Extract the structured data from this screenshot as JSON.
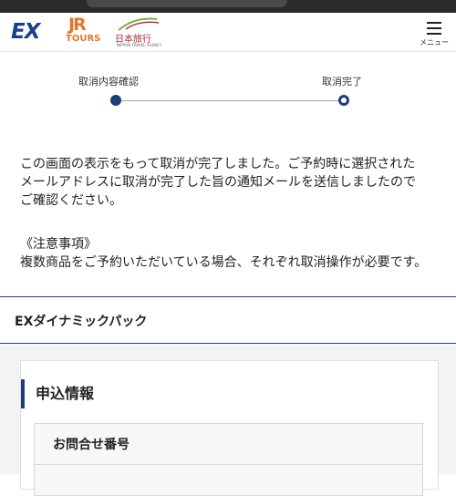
{
  "header": {
    "logo_ex": "EX",
    "logo_jr": "JR",
    "logo_tours": "TOURS",
    "logo_nta": "日本旅行",
    "logo_nta_sub": "NIPPON TRAVEL AGENCY",
    "menu_label": "メニュー"
  },
  "progress": {
    "steps": [
      {
        "label": "取消内容確認",
        "state": "done"
      },
      {
        "label": "取消完了",
        "state": "current"
      }
    ]
  },
  "message": {
    "lines": [
      "この画面の表示をもって取消が完了しました。ご予約時に選択された",
      "メールアドレスに取消が完了した旨の通知メールを送信しましたので",
      "ご確認ください。"
    ]
  },
  "notice": {
    "title": "《注意事項》",
    "text": "複数商品をご予約いただいている場合、それぞれ取消操作が必要です。"
  },
  "product": {
    "name": "EXダイナミックパック"
  },
  "application": {
    "heading": "申込情報",
    "inquiry_label": "お問合せ番号"
  },
  "colors": {
    "brand_navy": "#1e3d7a",
    "ex_blue": "#1b3f8f",
    "jr_orange": "#e0782a",
    "nta_red": "#b0263a"
  }
}
